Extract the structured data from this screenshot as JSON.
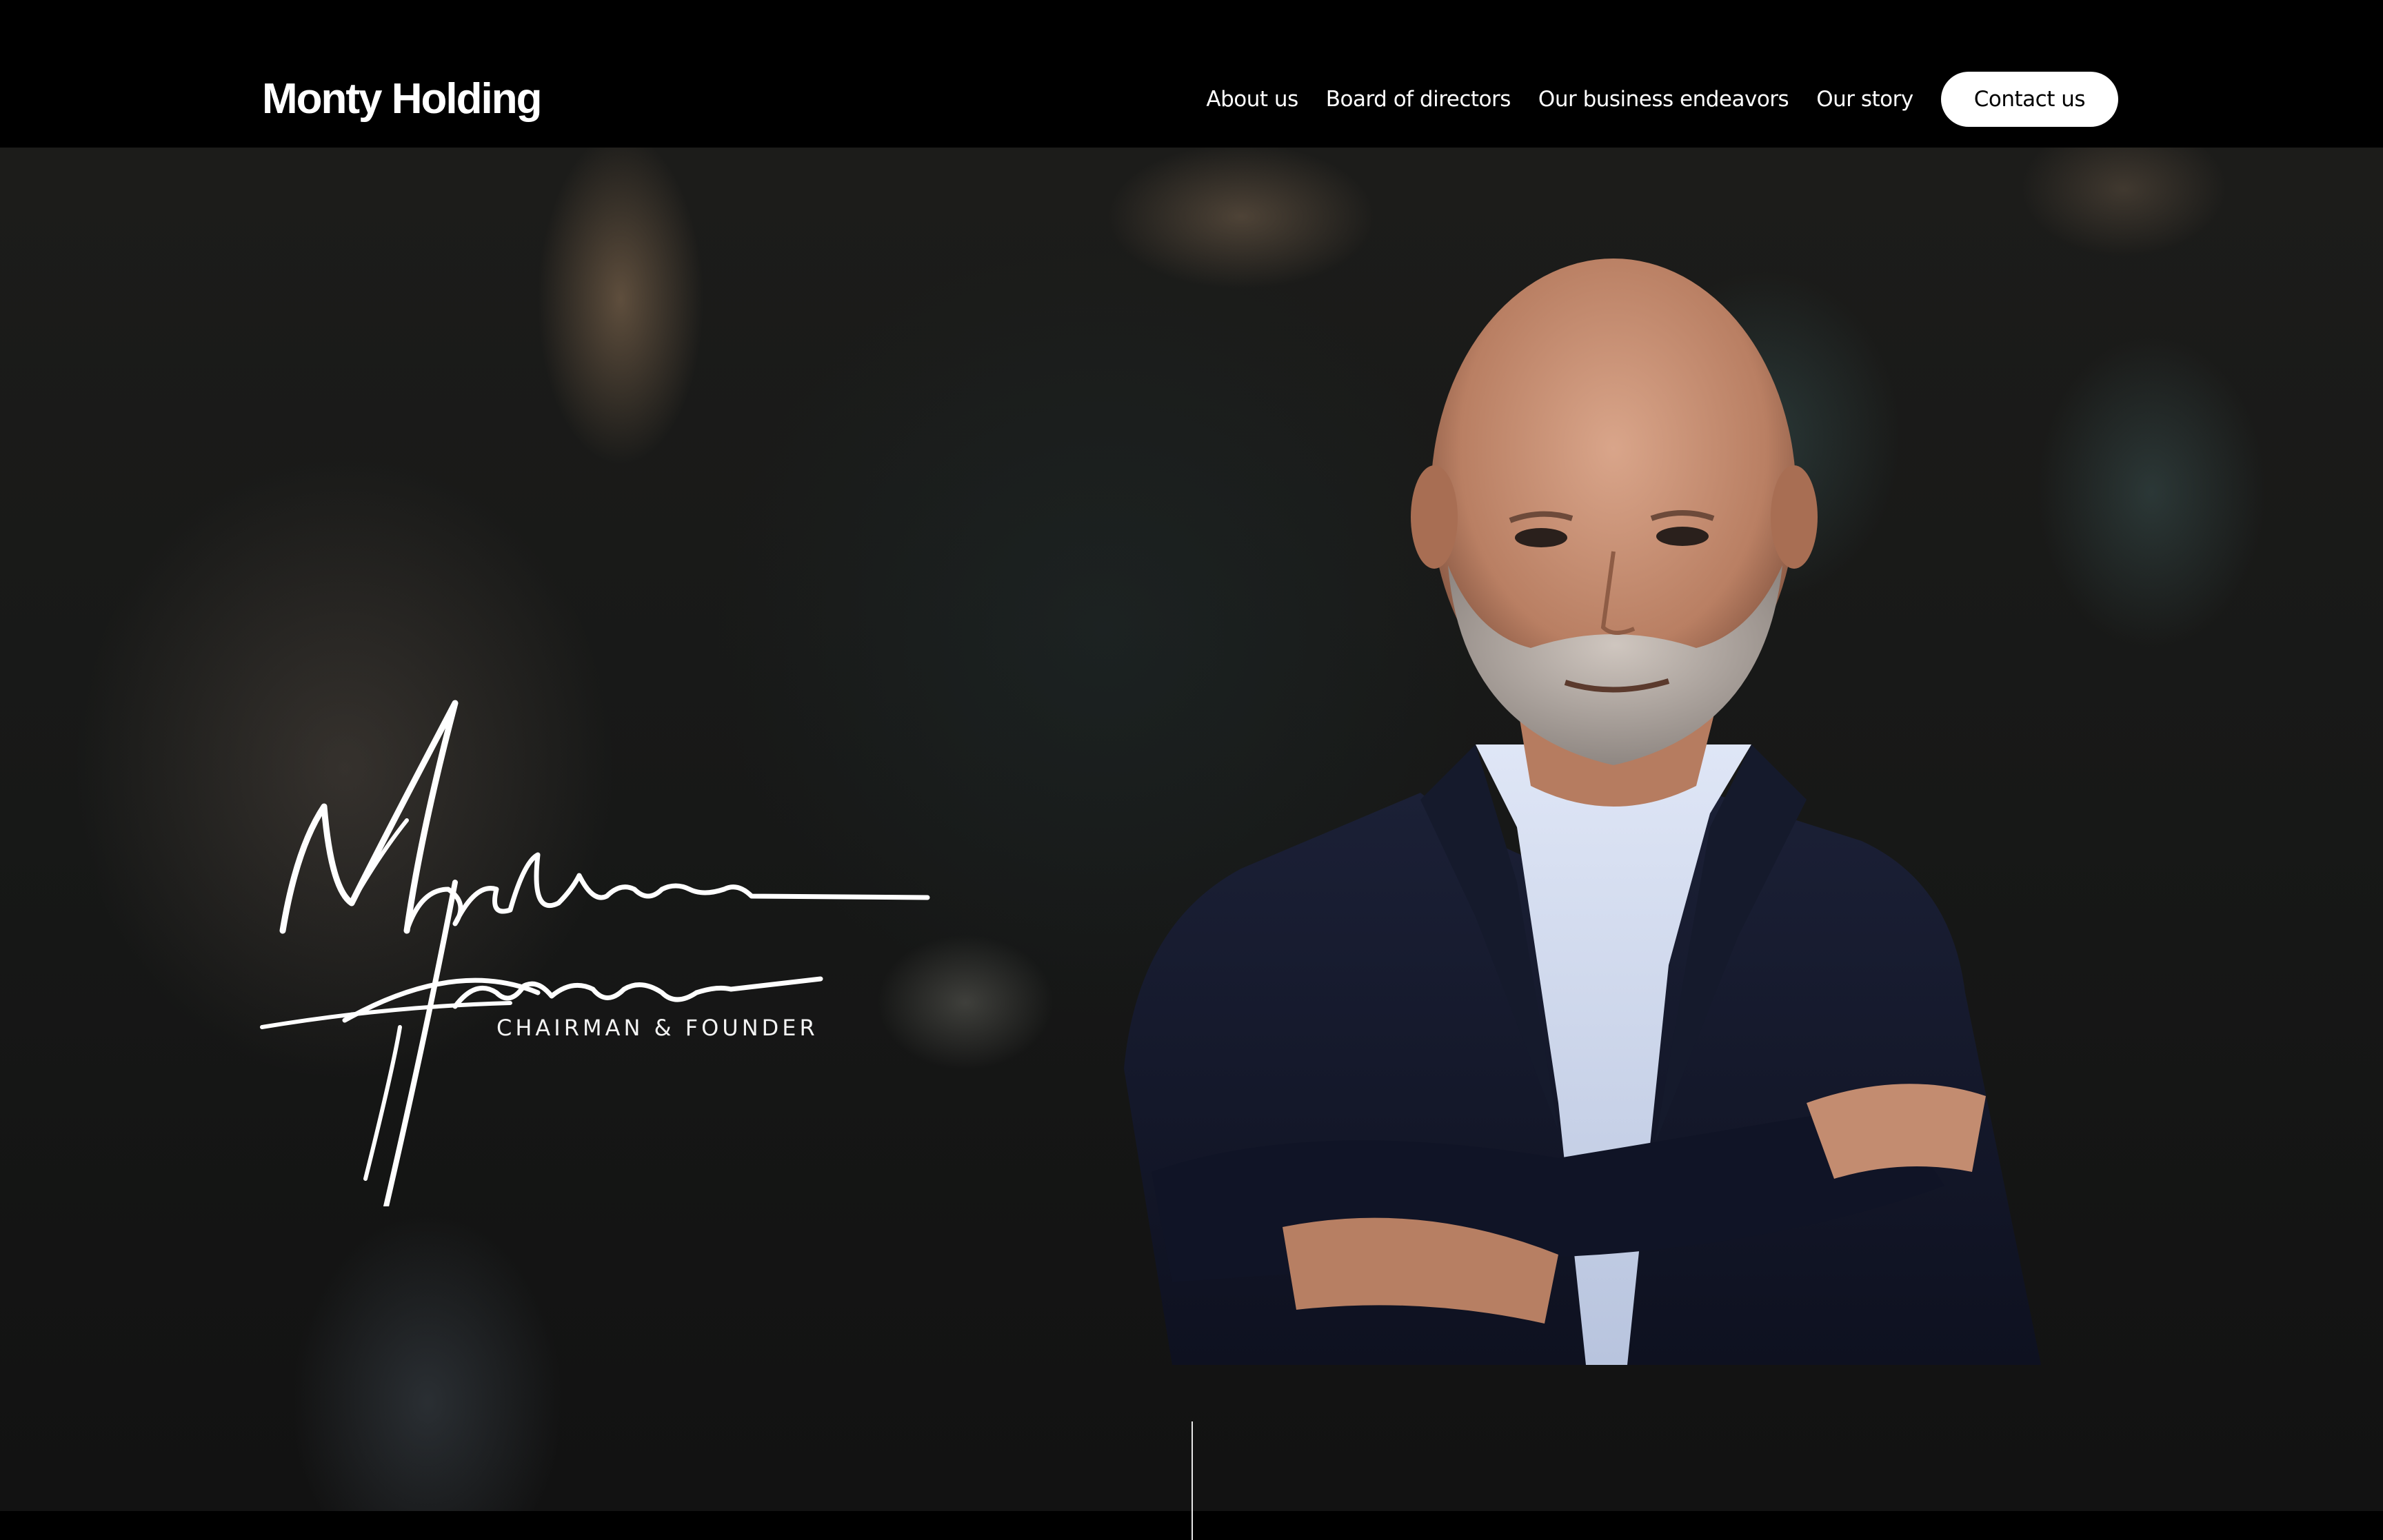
{
  "brand": {
    "name": "Monty Holding"
  },
  "nav": {
    "items": [
      "About us",
      "Board of directors",
      "Our business endeavors",
      "Our story"
    ],
    "cta": "Contact us"
  },
  "hero": {
    "signature_text": "Mountasser Hachem",
    "subtitle": "CHAIRMAN & FOUNDER"
  },
  "colors": {
    "header_bg": "#000000",
    "cta_bg": "#ffffff",
    "text": "#ffffff"
  }
}
